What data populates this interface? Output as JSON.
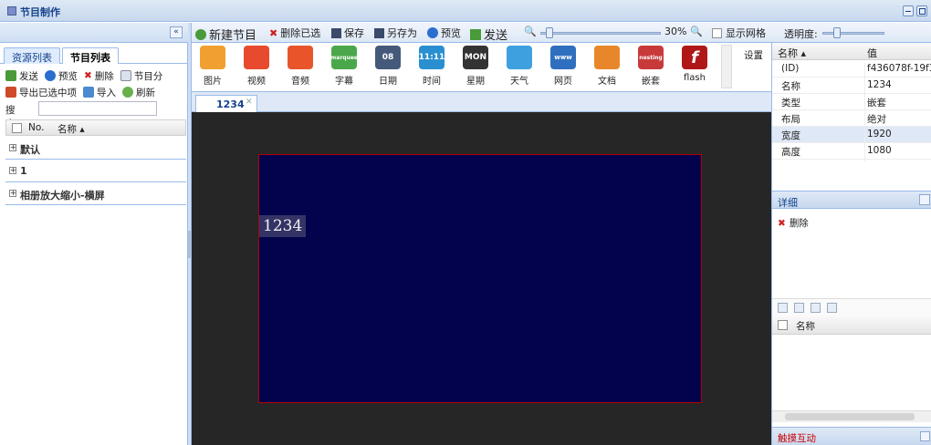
{
  "window": {
    "title": "节目制作"
  },
  "left": {
    "tabs": [
      "资源列表",
      "节目列表"
    ],
    "toolbar1": [
      "发送",
      "预览",
      "删除",
      "节目分"
    ],
    "toolbar2": [
      "导出已选中项",
      "导入",
      "刷新"
    ],
    "search_label": "搜索:",
    "search_value": "",
    "list_header": {
      "no": "No.",
      "name": "名称 ▴"
    },
    "groups": [
      "默认",
      "1",
      "相册放大缩小-横屏"
    ]
  },
  "toolbar": {
    "new_program": "新建节目",
    "delete_selected": "删除已选",
    "save": "保存",
    "save_as": "另存为",
    "preview": "预览",
    "send": "发送",
    "zoom": "30%",
    "show_grid": "显示网格",
    "transparency": "透明度:"
  },
  "palette": {
    "items": [
      {
        "label": "图片",
        "icon": "picture-icon",
        "color": "#f0a030"
      },
      {
        "label": "视频",
        "icon": "video-icon",
        "color": "#e84a2e"
      },
      {
        "label": "音频",
        "icon": "audio-icon",
        "color": "#e8552a"
      },
      {
        "label": "字幕",
        "icon": "marquee-icon",
        "color": "#4aa84a",
        "text": "marquee"
      },
      {
        "label": "日期",
        "icon": "calendar-icon",
        "color": "#455a7a",
        "text": "08"
      },
      {
        "label": "时间",
        "icon": "clock-icon",
        "color": "#2a8fd0",
        "text": "11:11"
      },
      {
        "label": "星期",
        "icon": "week-icon",
        "color": "#333333",
        "text": "MON"
      },
      {
        "label": "天气",
        "icon": "weather-icon",
        "color": "#3fa0e0"
      },
      {
        "label": "网页",
        "icon": "web-icon",
        "color": "#2f6fbf",
        "text": "www"
      },
      {
        "label": "文档",
        "icon": "document-icon",
        "color": "#e8872a"
      },
      {
        "label": "嵌套",
        "icon": "nesting-icon",
        "color": "#c83a3a",
        "text": "nesting"
      },
      {
        "label": "flash",
        "icon": "flash-icon",
        "color": "#b01818",
        "text": "f"
      }
    ],
    "settings": "设置"
  },
  "doc_tab": {
    "label": "1234"
  },
  "stage": {
    "label": "1234"
  },
  "props": {
    "header": {
      "name": "名称 ▴",
      "value": "值"
    },
    "rows": [
      {
        "k": "(ID)",
        "v": "f436078f-19f3..."
      },
      {
        "k": "名称",
        "v": "1234"
      },
      {
        "k": "类型",
        "v": "嵌套"
      },
      {
        "k": "布局",
        "v": "绝对"
      },
      {
        "k": "宽度",
        "v": "1920"
      },
      {
        "k": "高度",
        "v": "1080"
      }
    ]
  },
  "detail": {
    "title": "详细",
    "delete": "删除",
    "name_col": "名称",
    "touch": "触摸互动"
  }
}
